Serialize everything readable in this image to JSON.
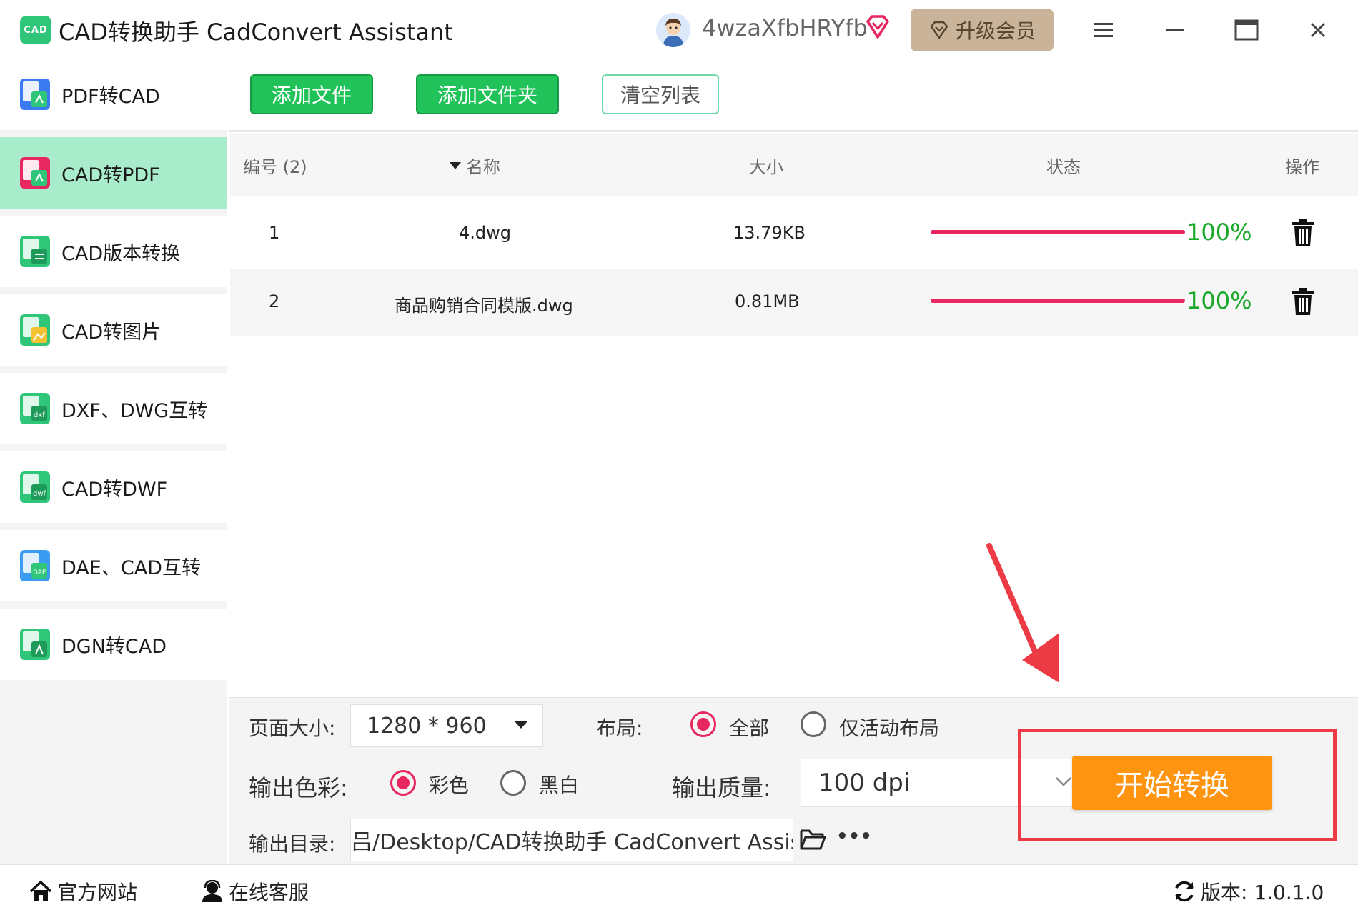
{
  "app": {
    "logo_text": "CAD",
    "title": "CAD转换助手 CadConvert Assistant",
    "username": "4wzaXfbHRYfb",
    "upgrade_label": "升级会员"
  },
  "sidebar": {
    "items": [
      {
        "label": "PDF转CAD",
        "icon": "pdf-to-cad-icon",
        "color": "#3a7cf0",
        "active": false
      },
      {
        "label": "CAD转PDF",
        "icon": "cad-to-pdf-icon",
        "color": "#e8265f",
        "active": true
      },
      {
        "label": "CAD版本转换",
        "icon": "cad-version-icon",
        "color": "#2fc67a",
        "active": false
      },
      {
        "label": "CAD转图片",
        "icon": "cad-to-image-icon",
        "color": "#2fc67a",
        "active": false
      },
      {
        "label": "DXF、DWG互转",
        "icon": "dxf-dwg-icon",
        "color": "#2fc67a",
        "active": false
      },
      {
        "label": "CAD转DWF",
        "icon": "cad-to-dwf-icon",
        "color": "#2fc67a",
        "active": false
      },
      {
        "label": "DAE、CAD互转",
        "icon": "dae-cad-icon",
        "color": "#3a9cf0",
        "active": false
      },
      {
        "label": "DGN转CAD",
        "icon": "dgn-to-cad-icon",
        "color": "#2fc67a",
        "active": false
      }
    ]
  },
  "toolbar": {
    "add_file": "添加文件",
    "add_folder": "添加文件夹",
    "clear_list": "清空列表"
  },
  "table": {
    "headers": {
      "number": "编号 (2)",
      "name": "名称",
      "size": "大小",
      "status": "状态",
      "action": "操作"
    },
    "rows": [
      {
        "num": "1",
        "name": "4.dwg",
        "size": "13.79KB",
        "progress": 100,
        "pct": "100%"
      },
      {
        "num": "2",
        "name": "商品购销合同模版.dwg",
        "size": "0.81MB",
        "progress": 100,
        "pct": "100%"
      }
    ]
  },
  "settings": {
    "page_size_label": "页面大小:",
    "page_size_value": "1280 * 960",
    "layout_label": "布局:",
    "layout_all": "全部",
    "layout_active": "仅活动布局",
    "color_label": "输出色彩:",
    "color_color": "彩色",
    "color_bw": "黑白",
    "quality_label": "输出质量:",
    "quality_value": "100 dpi",
    "output_dir_label": "输出目录:",
    "output_dir_value": "吕/Desktop/CAD转换助手 CadConvert Assistant",
    "more": "•••",
    "start_button": "开始转换"
  },
  "statusbar": {
    "website": "官方网站",
    "support": "在线客服",
    "version": "版本:  1.0.1.0"
  },
  "colors": {
    "accent_green": "#22c25a",
    "active_bg": "#a8eccb",
    "progress": "#e8265f",
    "pct_text": "#1aa82a",
    "start_button": "#ff9411",
    "annotation_red": "#ec3b45"
  }
}
